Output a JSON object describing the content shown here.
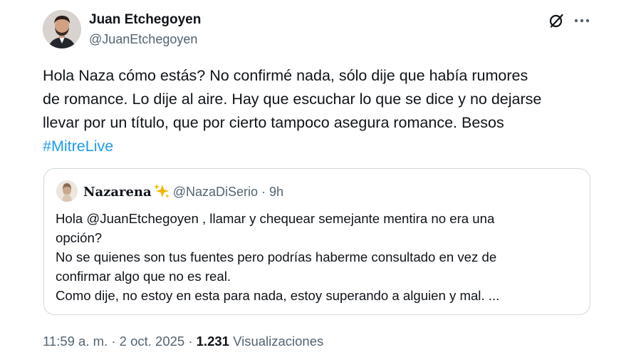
{
  "author": {
    "name": "Juan Etchegoyen",
    "handle": "@JuanEtchegoyen"
  },
  "header_icons": {
    "grok": "grok-icon",
    "more": "more-icon"
  },
  "tweet": {
    "lines": [
      "Hola Naza cómo estás? No confirmé nada, sólo dije que había rumores",
      "de romance. Lo dije al aire. Hay que escuchar lo que se dice y no dejarse",
      "llevar por un título, que por cierto tampoco asegura romance. Besos"
    ],
    "hashtag": "#MitreLive"
  },
  "quote": {
    "name": "Nazarena",
    "badge_icon": "sparkles-icon",
    "handle": "@NazaDiSerio",
    "dot": "·",
    "time": "9h",
    "lines": [
      "Hola @JuanEtchegoyen , llamar y chequear semejante mentira no era una",
      "opción?",
      "No se quienes son tus fuentes pero podrías haberme consultado en vez de",
      "confirmar algo que no es real.",
      "Como dije, no estoy en esta para nada, estoy superando a alguien y mal. ..."
    ]
  },
  "meta": {
    "time": "11:59 a. m.",
    "sep1": "·",
    "date": "2 oct. 2025",
    "sep2": "·",
    "views_count": "1.231",
    "views_label": "Visualizaciones"
  },
  "colors": {
    "link": "#1d9bf0",
    "secondary_text": "#536471",
    "primary_text": "#0f1419",
    "border": "#cfd9de"
  }
}
